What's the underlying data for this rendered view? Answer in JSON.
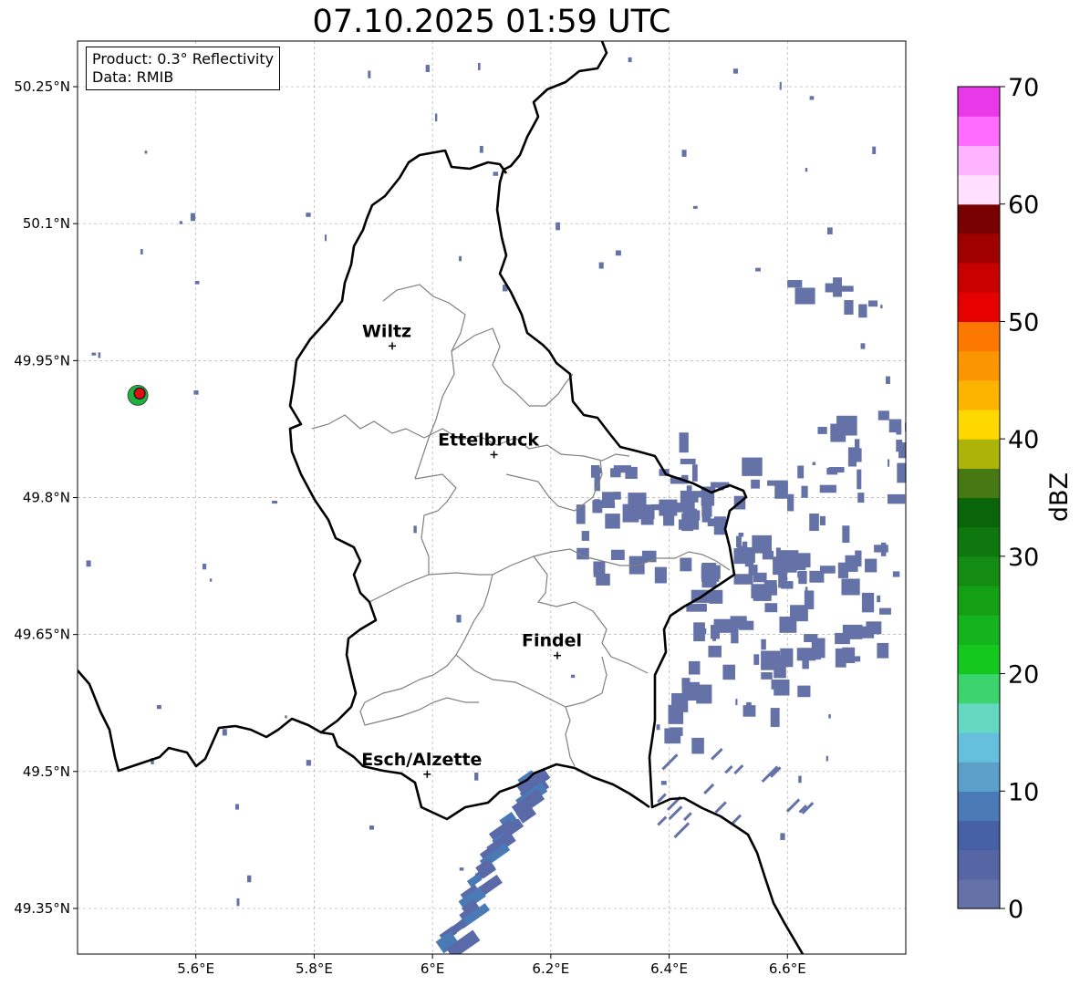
{
  "title": "07.10.2025 01:59 UTC",
  "info": {
    "product": "Product: 0.3° Reflectivity",
    "data": "Data: RMIB"
  },
  "extent": {
    "lon_min": 5.4,
    "lon_max": 6.8,
    "lat_min": 49.3,
    "lat_max": 50.3
  },
  "lat_ticks": [
    {
      "value": 50.25,
      "label": "50.25°N"
    },
    {
      "value": 50.1,
      "label": "50.1°N"
    },
    {
      "value": 49.95,
      "label": "49.95°N"
    },
    {
      "value": 49.8,
      "label": "49.8°N"
    },
    {
      "value": 49.65,
      "label": "49.65°N"
    },
    {
      "value": 49.5,
      "label": "49.5°N"
    },
    {
      "value": 49.35,
      "label": "49.35°N"
    }
  ],
  "lon_ticks": [
    {
      "value": 5.6,
      "label": "5.6°E"
    },
    {
      "value": 5.8,
      "label": "5.8°E"
    },
    {
      "value": 6.0,
      "label": "6°E"
    },
    {
      "value": 6.2,
      "label": "6.2°E"
    },
    {
      "value": 6.4,
      "label": "6.4°E"
    },
    {
      "value": 6.6,
      "label": "6.6°E"
    }
  ],
  "cities": [
    {
      "name": "Wiltz",
      "lon": 5.932,
      "lat": 49.966
    },
    {
      "name": "Ettelbruck",
      "lon": 6.104,
      "lat": 49.847
    },
    {
      "name": "Findel",
      "lon": 6.211,
      "lat": 49.627
    },
    {
      "name": "Esch/Alzette",
      "lon": 5.991,
      "lat": 49.497
    }
  ],
  "radar_site": {
    "lon": 5.505,
    "lat": 49.914
  },
  "colorbar": {
    "label": "dBZ",
    "ticks": [
      0,
      10,
      20,
      30,
      40,
      50,
      60,
      70
    ],
    "colors": [
      "#6472a8",
      "#5666a4",
      "#4660a6",
      "#4a7ab6",
      "#5aa0c8",
      "#64c0dc",
      "#64d8c0",
      "#3cd46c",
      "#14c81e",
      "#14b41e",
      "#14a014",
      "#148c14",
      "#0e780e",
      "#0a640a",
      "#467814",
      "#acb40a",
      "#ffd800",
      "#fcb400",
      "#fc9600",
      "#fc7800",
      "#e60000",
      "#c80000",
      "#a00000",
      "#780000",
      "#ffe0ff",
      "#ffb4ff",
      "#ff6cff",
      "#e838e8"
    ]
  },
  "colors": {
    "border": "#000000",
    "canton": "#808080",
    "grid": "#b0b0b0",
    "echo": "#6472a8",
    "radar_red": "#e01010",
    "radar_green": "#20b040"
  }
}
